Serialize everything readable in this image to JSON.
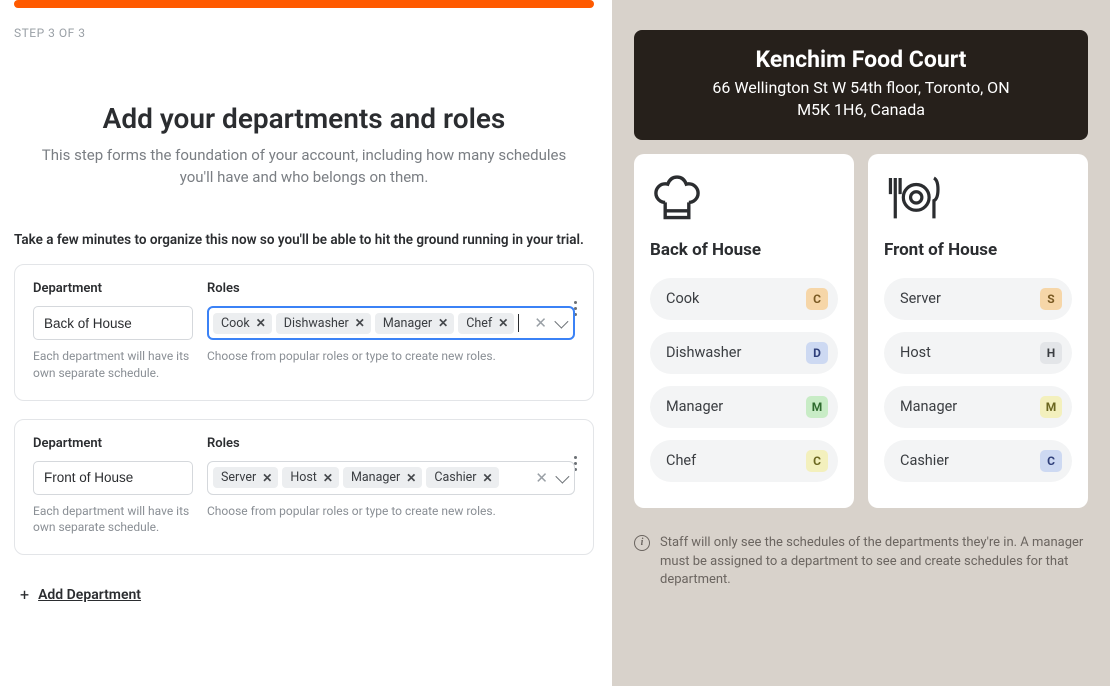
{
  "progress": {
    "step_label": "STEP 3 OF 3",
    "percent": 100
  },
  "header": {
    "title": "Add your departments and roles",
    "subtitle": "This step forms the foundation of your account, including how many schedules you'll have and who belongs on them.",
    "intro": "Take a few minutes to organize this now so you'll be able to hit the ground running in your trial."
  },
  "labels": {
    "department": "Department",
    "roles": "Roles",
    "dept_helper": "Each department will have its own separate schedule.",
    "roles_helper": "Choose from popular roles or type to create new roles.",
    "add_department": "Add Department"
  },
  "departments": [
    {
      "name": "Back of House",
      "focused": true,
      "roles": [
        "Cook",
        "Dishwasher",
        "Manager",
        "Chef"
      ]
    },
    {
      "name": "Front of House",
      "focused": false,
      "roles": [
        "Server",
        "Host",
        "Manager",
        "Cashier"
      ]
    }
  ],
  "location": {
    "name": "Kenchim Food Court",
    "address_line1": "66 Wellington St W 54th floor, Toronto, ON",
    "address_line2": "M5K 1H6, Canada"
  },
  "preview": [
    {
      "icon": "chef-hat",
      "title": "Back of House",
      "roles": [
        {
          "name": "Cook",
          "badge": "C",
          "bg": "#f6d6a8",
          "fg": "#7a5a23"
        },
        {
          "name": "Dishwasher",
          "badge": "D",
          "bg": "#cdd9f2",
          "fg": "#2f3f7a"
        },
        {
          "name": "Manager",
          "badge": "M",
          "bg": "#c8ecc6",
          "fg": "#2f6b2f"
        },
        {
          "name": "Chef",
          "badge": "C",
          "bg": "#f3f0bd",
          "fg": "#6b6720"
        }
      ]
    },
    {
      "icon": "dining",
      "title": "Front of House",
      "roles": [
        {
          "name": "Server",
          "badge": "S",
          "bg": "#f6d6a8",
          "fg": "#7a5a23"
        },
        {
          "name": "Host",
          "badge": "H",
          "bg": "#e3e5e8",
          "fg": "#3a3d41"
        },
        {
          "name": "Manager",
          "badge": "M",
          "bg": "#f3f0bd",
          "fg": "#6b6720"
        },
        {
          "name": "Cashier",
          "badge": "C",
          "bg": "#cdd9f2",
          "fg": "#2f3f7a"
        }
      ]
    }
  ],
  "info_note": "Staff will only see the schedules of the departments they're in. A manager must be assigned to a department to see and create schedules for that department."
}
